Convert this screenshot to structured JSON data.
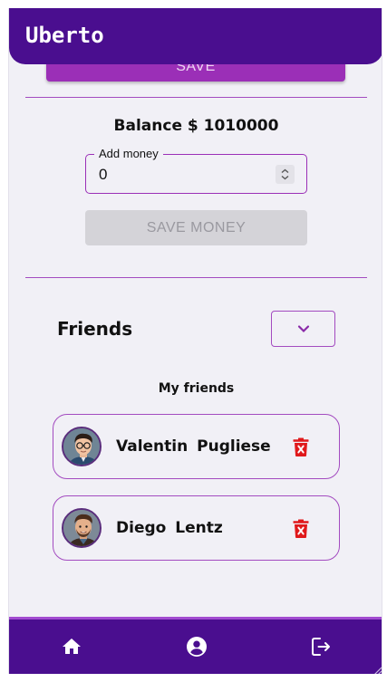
{
  "app": {
    "title": "Uberto"
  },
  "top_action": {
    "save_label": "SAVE"
  },
  "wallet": {
    "balance_text": "Balance $ 1010000",
    "add_money_label": "Add money",
    "add_money_value": "0",
    "save_money_label": "SAVE MONEY"
  },
  "friends": {
    "title": "Friends",
    "list_title": "My friends",
    "items": [
      {
        "name": "Valentin  Pugliese",
        "avatar": "avatar-glasses-man"
      },
      {
        "name": "Diego  Lentz",
        "avatar": "avatar-smiling-man"
      }
    ]
  },
  "nav": {
    "items": [
      {
        "icon": "home-icon"
      },
      {
        "icon": "account-circle-icon"
      },
      {
        "icon": "logout-icon"
      }
    ]
  },
  "colors": {
    "primary": "#4a0e8f",
    "accent": "#9b2fb7",
    "background": "#f1f0f6",
    "delete": "#e0191b"
  }
}
